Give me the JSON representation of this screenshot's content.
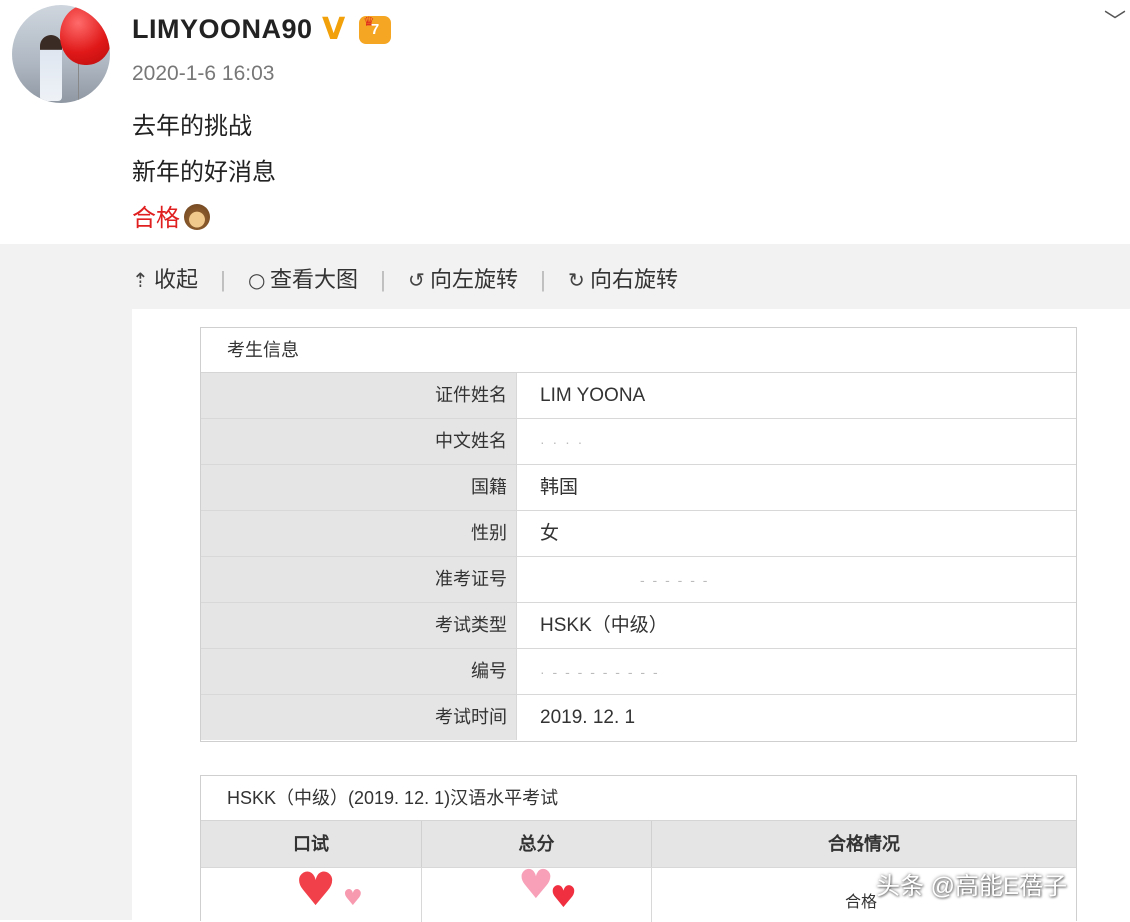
{
  "post": {
    "username": "LIMYOONA90",
    "verified_icon": "V",
    "member_badge": "7",
    "timestamp": "2020-1-6 16:03",
    "lines": [
      "去年的挑战",
      "新年的好消息",
      "合格"
    ],
    "emoji": "see-no-evil-monkey-icon"
  },
  "toolbar": {
    "collapse": "收起",
    "view_large": "查看大图",
    "rotate_left": "向左旋转",
    "rotate_right": "向右旋转"
  },
  "exam_info": {
    "title": "考生信息",
    "rows": [
      {
        "label": "证件姓名",
        "value": "LIM YOONA"
      },
      {
        "label": "中文姓名",
        "value": ""
      },
      {
        "label": "国籍",
        "value": "韩国"
      },
      {
        "label": "性别",
        "value": "女"
      },
      {
        "label": "准考证号",
        "value": ""
      },
      {
        "label": "考试类型",
        "value": "HSKK（中级）"
      },
      {
        "label": "编号",
        "value": ""
      },
      {
        "label": "考试时间",
        "value": "2019. 12. 1"
      }
    ]
  },
  "result": {
    "title": "HSKK（中级）(2019. 12. 1)汉语水平考试",
    "headers": [
      "口试",
      "总分",
      "合格情况"
    ],
    "pass_partial": "合格"
  },
  "watermark": "头条 @高能E蓓子",
  "colors": {
    "accent_red": "#e02020",
    "verified_gold": "#f2a10a",
    "badge_orange": "#f5a623"
  }
}
